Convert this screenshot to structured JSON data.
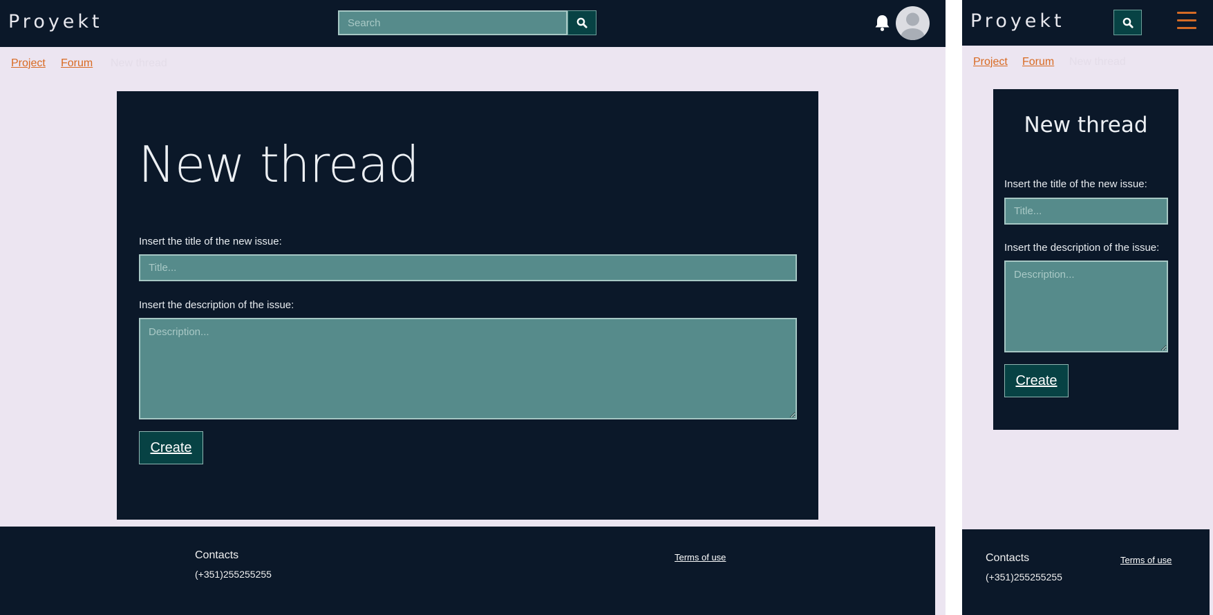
{
  "app": {
    "logo": "Proyekt"
  },
  "header": {
    "search_placeholder": "Search"
  },
  "breadcrumb": {
    "project": "Project",
    "forum": "Forum",
    "current": "New thread"
  },
  "form": {
    "heading": "New thread",
    "title_label": "Insert the title of the new issue:",
    "title_placeholder": "Title...",
    "description_label": "Insert the description of the issue:",
    "description_placeholder": "Description...",
    "create_label": "Create"
  },
  "footer": {
    "contacts_heading": "Contacts",
    "phone": "(+351)255255255",
    "terms_link": "Terms of use"
  },
  "icons": {
    "search": "search-icon",
    "bell": "bell-icon",
    "avatar": "avatar",
    "menu": "hamburger-menu-icon"
  },
  "colors": {
    "header_bg": "#0b1829",
    "page_bg": "#ece5f1",
    "input_bg": "#568b8b",
    "button_bg": "#074244",
    "accent": "#d86a22"
  }
}
